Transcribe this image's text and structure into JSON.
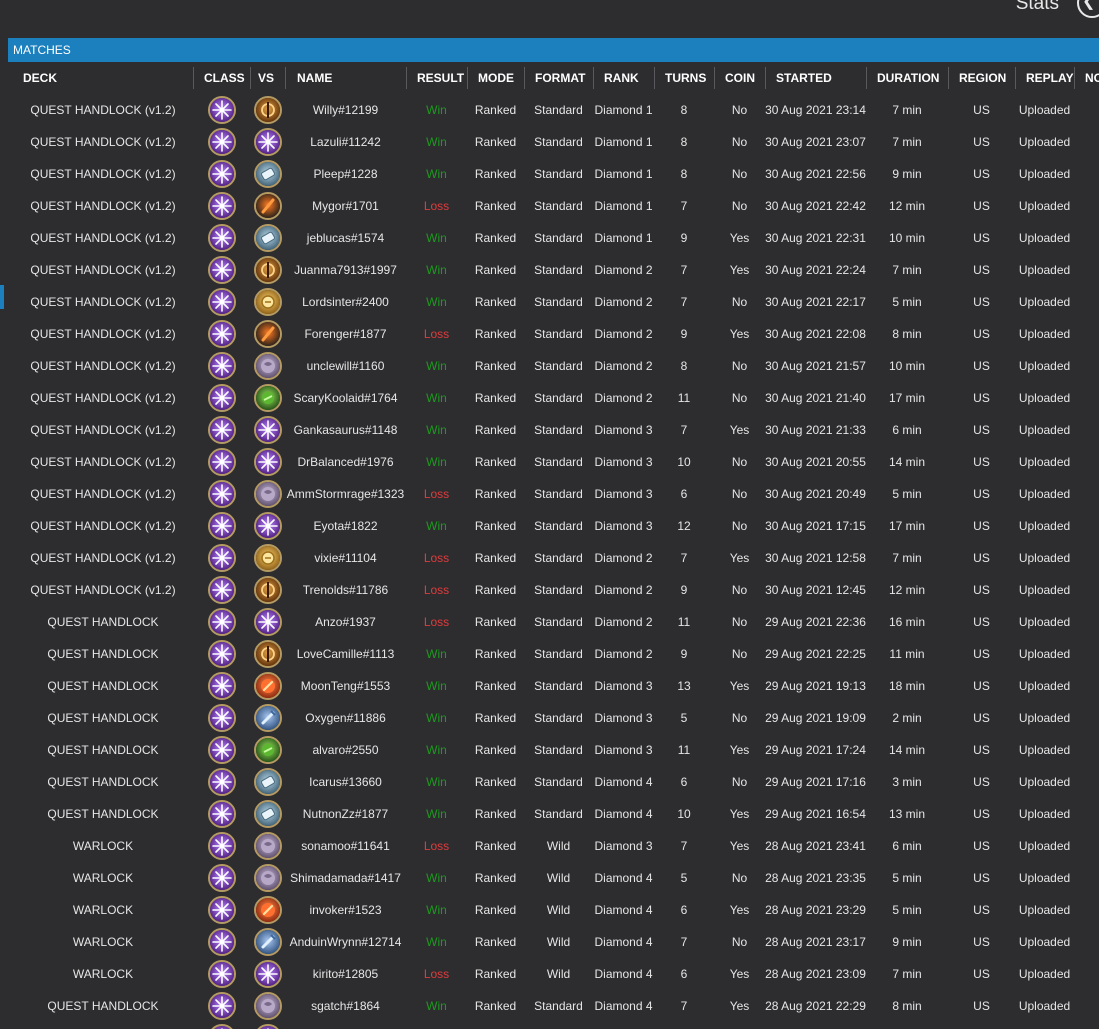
{
  "window": {
    "title": "Stats"
  },
  "section": {
    "title": "MATCHES"
  },
  "columns": [
    "DECK",
    "CLASS",
    "VS",
    "NAME",
    "RESULT",
    "MODE",
    "FORMAT",
    "RANK",
    "TURNS",
    "COIN",
    "STARTED",
    "DURATION",
    "REGION",
    "REPLAY",
    "NO"
  ],
  "icons": {
    "warlock": "warlock-class-icon",
    "warrior": "warrior-class-icon",
    "priest": "priest-class-icon",
    "rogue": "rogue-class-icon",
    "paladin": "paladin-class-icon",
    "druid": "druid-class-icon",
    "hunter": "hunter-class-icon",
    "mage": "mage-class-icon",
    "shaman": "shaman-class-icon"
  },
  "colors": {
    "accent": "#1c7fbe",
    "win": "#1e9a1e",
    "loss": "#e23b3b",
    "background": "#2d2d30"
  },
  "matches": [
    {
      "deck": "QUEST HANDLOCK (v1.2)",
      "vs": "warrior",
      "name": "Willy#12199",
      "result": "Win",
      "mode": "Ranked",
      "format": "Standard",
      "rank": "Diamond 1",
      "turns": "8",
      "coin": "No",
      "started": "30 Aug 2021 23:14",
      "duration": "7 min",
      "region": "US",
      "replay": "Uploaded"
    },
    {
      "deck": "QUEST HANDLOCK (v1.2)",
      "vs": "warlock",
      "name": "Lazuli#11242",
      "result": "Win",
      "mode": "Ranked",
      "format": "Standard",
      "rank": "Diamond 1",
      "turns": "8",
      "coin": "No",
      "started": "30 Aug 2021 23:07",
      "duration": "7 min",
      "region": "US",
      "replay": "Uploaded"
    },
    {
      "deck": "QUEST HANDLOCK (v1.2)",
      "vs": "priest",
      "name": "Pleep#1228",
      "result": "Win",
      "mode": "Ranked",
      "format": "Standard",
      "rank": "Diamond 1",
      "turns": "8",
      "coin": "No",
      "started": "30 Aug 2021 22:56",
      "duration": "9 min",
      "region": "US",
      "replay": "Uploaded"
    },
    {
      "deck": "QUEST HANDLOCK (v1.2)",
      "vs": "rogue",
      "name": "Mygor#1701",
      "result": "Loss",
      "mode": "Ranked",
      "format": "Standard",
      "rank": "Diamond 1",
      "turns": "7",
      "coin": "No",
      "started": "30 Aug 2021 22:42",
      "duration": "12 min",
      "region": "US",
      "replay": "Uploaded"
    },
    {
      "deck": "QUEST HANDLOCK (v1.2)",
      "vs": "priest",
      "name": "jeblucas#1574",
      "result": "Win",
      "mode": "Ranked",
      "format": "Standard",
      "rank": "Diamond 1",
      "turns": "9",
      "coin": "Yes",
      "started": "30 Aug 2021 22:31",
      "duration": "10 min",
      "region": "US",
      "replay": "Uploaded"
    },
    {
      "deck": "QUEST HANDLOCK (v1.2)",
      "vs": "warrior",
      "name": "Juanma7913#1997",
      "result": "Win",
      "mode": "Ranked",
      "format": "Standard",
      "rank": "Diamond 2",
      "turns": "7",
      "coin": "Yes",
      "started": "30 Aug 2021 22:24",
      "duration": "7 min",
      "region": "US",
      "replay": "Uploaded"
    },
    {
      "deck": "QUEST HANDLOCK (v1.2)",
      "vs": "paladin",
      "name": "Lordsinter#2400",
      "result": "Win",
      "mode": "Ranked",
      "format": "Standard",
      "rank": "Diamond 2",
      "turns": "7",
      "coin": "No",
      "started": "30 Aug 2021 22:17",
      "duration": "5 min",
      "region": "US",
      "replay": "Uploaded"
    },
    {
      "deck": "QUEST HANDLOCK (v1.2)",
      "vs": "rogue",
      "name": "Forenger#1877",
      "result": "Loss",
      "mode": "Ranked",
      "format": "Standard",
      "rank": "Diamond 2",
      "turns": "9",
      "coin": "Yes",
      "started": "30 Aug 2021 22:08",
      "duration": "8 min",
      "region": "US",
      "replay": "Uploaded"
    },
    {
      "deck": "QUEST HANDLOCK (v1.2)",
      "vs": "druid",
      "name": "unclewill#1160",
      "result": "Win",
      "mode": "Ranked",
      "format": "Standard",
      "rank": "Diamond 2",
      "turns": "8",
      "coin": "No",
      "started": "30 Aug 2021 21:57",
      "duration": "10 min",
      "region": "US",
      "replay": "Uploaded"
    },
    {
      "deck": "QUEST HANDLOCK (v1.2)",
      "vs": "hunter",
      "name": "ScaryKoolaid#1764",
      "result": "Win",
      "mode": "Ranked",
      "format": "Standard",
      "rank": "Diamond 2",
      "turns": "11",
      "coin": "No",
      "started": "30 Aug 2021 21:40",
      "duration": "17 min",
      "region": "US",
      "replay": "Uploaded"
    },
    {
      "deck": "QUEST HANDLOCK (v1.2)",
      "vs": "warlock",
      "name": "Gankasaurus#1148",
      "result": "Win",
      "mode": "Ranked",
      "format": "Standard",
      "rank": "Diamond 3",
      "turns": "7",
      "coin": "Yes",
      "started": "30 Aug 2021 21:33",
      "duration": "6 min",
      "region": "US",
      "replay": "Uploaded"
    },
    {
      "deck": "QUEST HANDLOCK (v1.2)",
      "vs": "warlock",
      "name": "DrBalanced#1976",
      "result": "Win",
      "mode": "Ranked",
      "format": "Standard",
      "rank": "Diamond 3",
      "turns": "10",
      "coin": "No",
      "started": "30 Aug 2021 20:55",
      "duration": "14 min",
      "region": "US",
      "replay": "Uploaded"
    },
    {
      "deck": "QUEST HANDLOCK (v1.2)",
      "vs": "druid",
      "name": "AmmStormrage#1323",
      "result": "Loss",
      "mode": "Ranked",
      "format": "Standard",
      "rank": "Diamond 3",
      "turns": "6",
      "coin": "No",
      "started": "30 Aug 2021 20:49",
      "duration": "5 min",
      "region": "US",
      "replay": "Uploaded"
    },
    {
      "deck": "QUEST HANDLOCK (v1.2)",
      "vs": "warlock",
      "name": "Eyota#1822",
      "result": "Win",
      "mode": "Ranked",
      "format": "Standard",
      "rank": "Diamond 3",
      "turns": "12",
      "coin": "No",
      "started": "30 Aug 2021 17:15",
      "duration": "17 min",
      "region": "US",
      "replay": "Uploaded"
    },
    {
      "deck": "QUEST HANDLOCK (v1.2)",
      "vs": "paladin",
      "name": "vixie#11104",
      "result": "Loss",
      "mode": "Ranked",
      "format": "Standard",
      "rank": "Diamond 2",
      "turns": "7",
      "coin": "Yes",
      "started": "30 Aug 2021 12:58",
      "duration": "7 min",
      "region": "US",
      "replay": "Uploaded"
    },
    {
      "deck": "QUEST HANDLOCK (v1.2)",
      "vs": "warrior",
      "name": "Trenolds#11786",
      "result": "Loss",
      "mode": "Ranked",
      "format": "Standard",
      "rank": "Diamond 2",
      "turns": "9",
      "coin": "No",
      "started": "30 Aug 2021 12:45",
      "duration": "12 min",
      "region": "US",
      "replay": "Uploaded"
    },
    {
      "deck": "QUEST HANDLOCK",
      "vs": "warlock",
      "name": "Anzo#1937",
      "result": "Loss",
      "mode": "Ranked",
      "format": "Standard",
      "rank": "Diamond 2",
      "turns": "11",
      "coin": "No",
      "started": "29 Aug 2021 22:36",
      "duration": "16 min",
      "region": "US",
      "replay": "Uploaded"
    },
    {
      "deck": "QUEST HANDLOCK",
      "vs": "warrior",
      "name": "LoveCamille#1113",
      "result": "Win",
      "mode": "Ranked",
      "format": "Standard",
      "rank": "Diamond 2",
      "turns": "9",
      "coin": "No",
      "started": "29 Aug 2021 22:25",
      "duration": "11 min",
      "region": "US",
      "replay": "Uploaded"
    },
    {
      "deck": "QUEST HANDLOCK",
      "vs": "mage",
      "name": "MoonTeng#1553",
      "result": "Win",
      "mode": "Ranked",
      "format": "Standard",
      "rank": "Diamond 3",
      "turns": "13",
      "coin": "Yes",
      "started": "29 Aug 2021 19:13",
      "duration": "18 min",
      "region": "US",
      "replay": "Uploaded"
    },
    {
      "deck": "QUEST HANDLOCK",
      "vs": "shaman",
      "name": "Oxygen#11886",
      "result": "Win",
      "mode": "Ranked",
      "format": "Standard",
      "rank": "Diamond 3",
      "turns": "5",
      "coin": "No",
      "started": "29 Aug 2021 19:09",
      "duration": "2 min",
      "region": "US",
      "replay": "Uploaded"
    },
    {
      "deck": "QUEST HANDLOCK",
      "vs": "hunter",
      "name": "alvaro#2550",
      "result": "Win",
      "mode": "Ranked",
      "format": "Standard",
      "rank": "Diamond 3",
      "turns": "11",
      "coin": "Yes",
      "started": "29 Aug 2021 17:24",
      "duration": "14 min",
      "region": "US",
      "replay": "Uploaded"
    },
    {
      "deck": "QUEST HANDLOCK",
      "vs": "priest",
      "name": "Icarus#13660",
      "result": "Win",
      "mode": "Ranked",
      "format": "Standard",
      "rank": "Diamond 4",
      "turns": "6",
      "coin": "No",
      "started": "29 Aug 2021 17:16",
      "duration": "3 min",
      "region": "US",
      "replay": "Uploaded"
    },
    {
      "deck": "QUEST HANDLOCK",
      "vs": "priest",
      "name": "NutnonZz#1877",
      "result": "Win",
      "mode": "Ranked",
      "format": "Standard",
      "rank": "Diamond 4",
      "turns": "10",
      "coin": "Yes",
      "started": "29 Aug 2021 16:54",
      "duration": "13 min",
      "region": "US",
      "replay": "Uploaded"
    },
    {
      "deck": "WARLOCK",
      "vs": "druid",
      "name": "sonamoo#11641",
      "result": "Loss",
      "mode": "Ranked",
      "format": "Wild",
      "rank": "Diamond 3",
      "turns": "7",
      "coin": "Yes",
      "started": "28 Aug 2021 23:41",
      "duration": "6 min",
      "region": "US",
      "replay": "Uploaded"
    },
    {
      "deck": "WARLOCK",
      "vs": "druid",
      "name": "Shimadamada#1417",
      "result": "Win",
      "mode": "Ranked",
      "format": "Wild",
      "rank": "Diamond 4",
      "turns": "5",
      "coin": "No",
      "started": "28 Aug 2021 23:35",
      "duration": "5 min",
      "region": "US",
      "replay": "Uploaded"
    },
    {
      "deck": "WARLOCK",
      "vs": "mage",
      "name": "invoker#1523",
      "result": "Win",
      "mode": "Ranked",
      "format": "Wild",
      "rank": "Diamond 4",
      "turns": "6",
      "coin": "Yes",
      "started": "28 Aug 2021 23:29",
      "duration": "5 min",
      "region": "US",
      "replay": "Uploaded"
    },
    {
      "deck": "WARLOCK",
      "vs": "shaman",
      "name": "AnduinWrynn#12714",
      "result": "Win",
      "mode": "Ranked",
      "format": "Wild",
      "rank": "Diamond 4",
      "turns": "7",
      "coin": "No",
      "started": "28 Aug 2021 23:17",
      "duration": "9 min",
      "region": "US",
      "replay": "Uploaded"
    },
    {
      "deck": "WARLOCK",
      "vs": "warlock",
      "name": "kirito#12805",
      "result": "Loss",
      "mode": "Ranked",
      "format": "Wild",
      "rank": "Diamond 4",
      "turns": "6",
      "coin": "Yes",
      "started": "28 Aug 2021 23:09",
      "duration": "7 min",
      "region": "US",
      "replay": "Uploaded"
    },
    {
      "deck": "QUEST HANDLOCK",
      "vs": "druid",
      "name": "sgatch#1864",
      "result": "Win",
      "mode": "Ranked",
      "format": "Standard",
      "rank": "Diamond 4",
      "turns": "7",
      "coin": "Yes",
      "started": "28 Aug 2021 22:29",
      "duration": "8 min",
      "region": "US",
      "replay": "Uploaded"
    },
    {
      "deck": "",
      "vs": "warlock",
      "name": "",
      "result": "",
      "mode": "",
      "format": "",
      "rank": "",
      "turns": "",
      "coin": "",
      "started": "",
      "duration": "",
      "region": "",
      "replay": ""
    }
  ]
}
